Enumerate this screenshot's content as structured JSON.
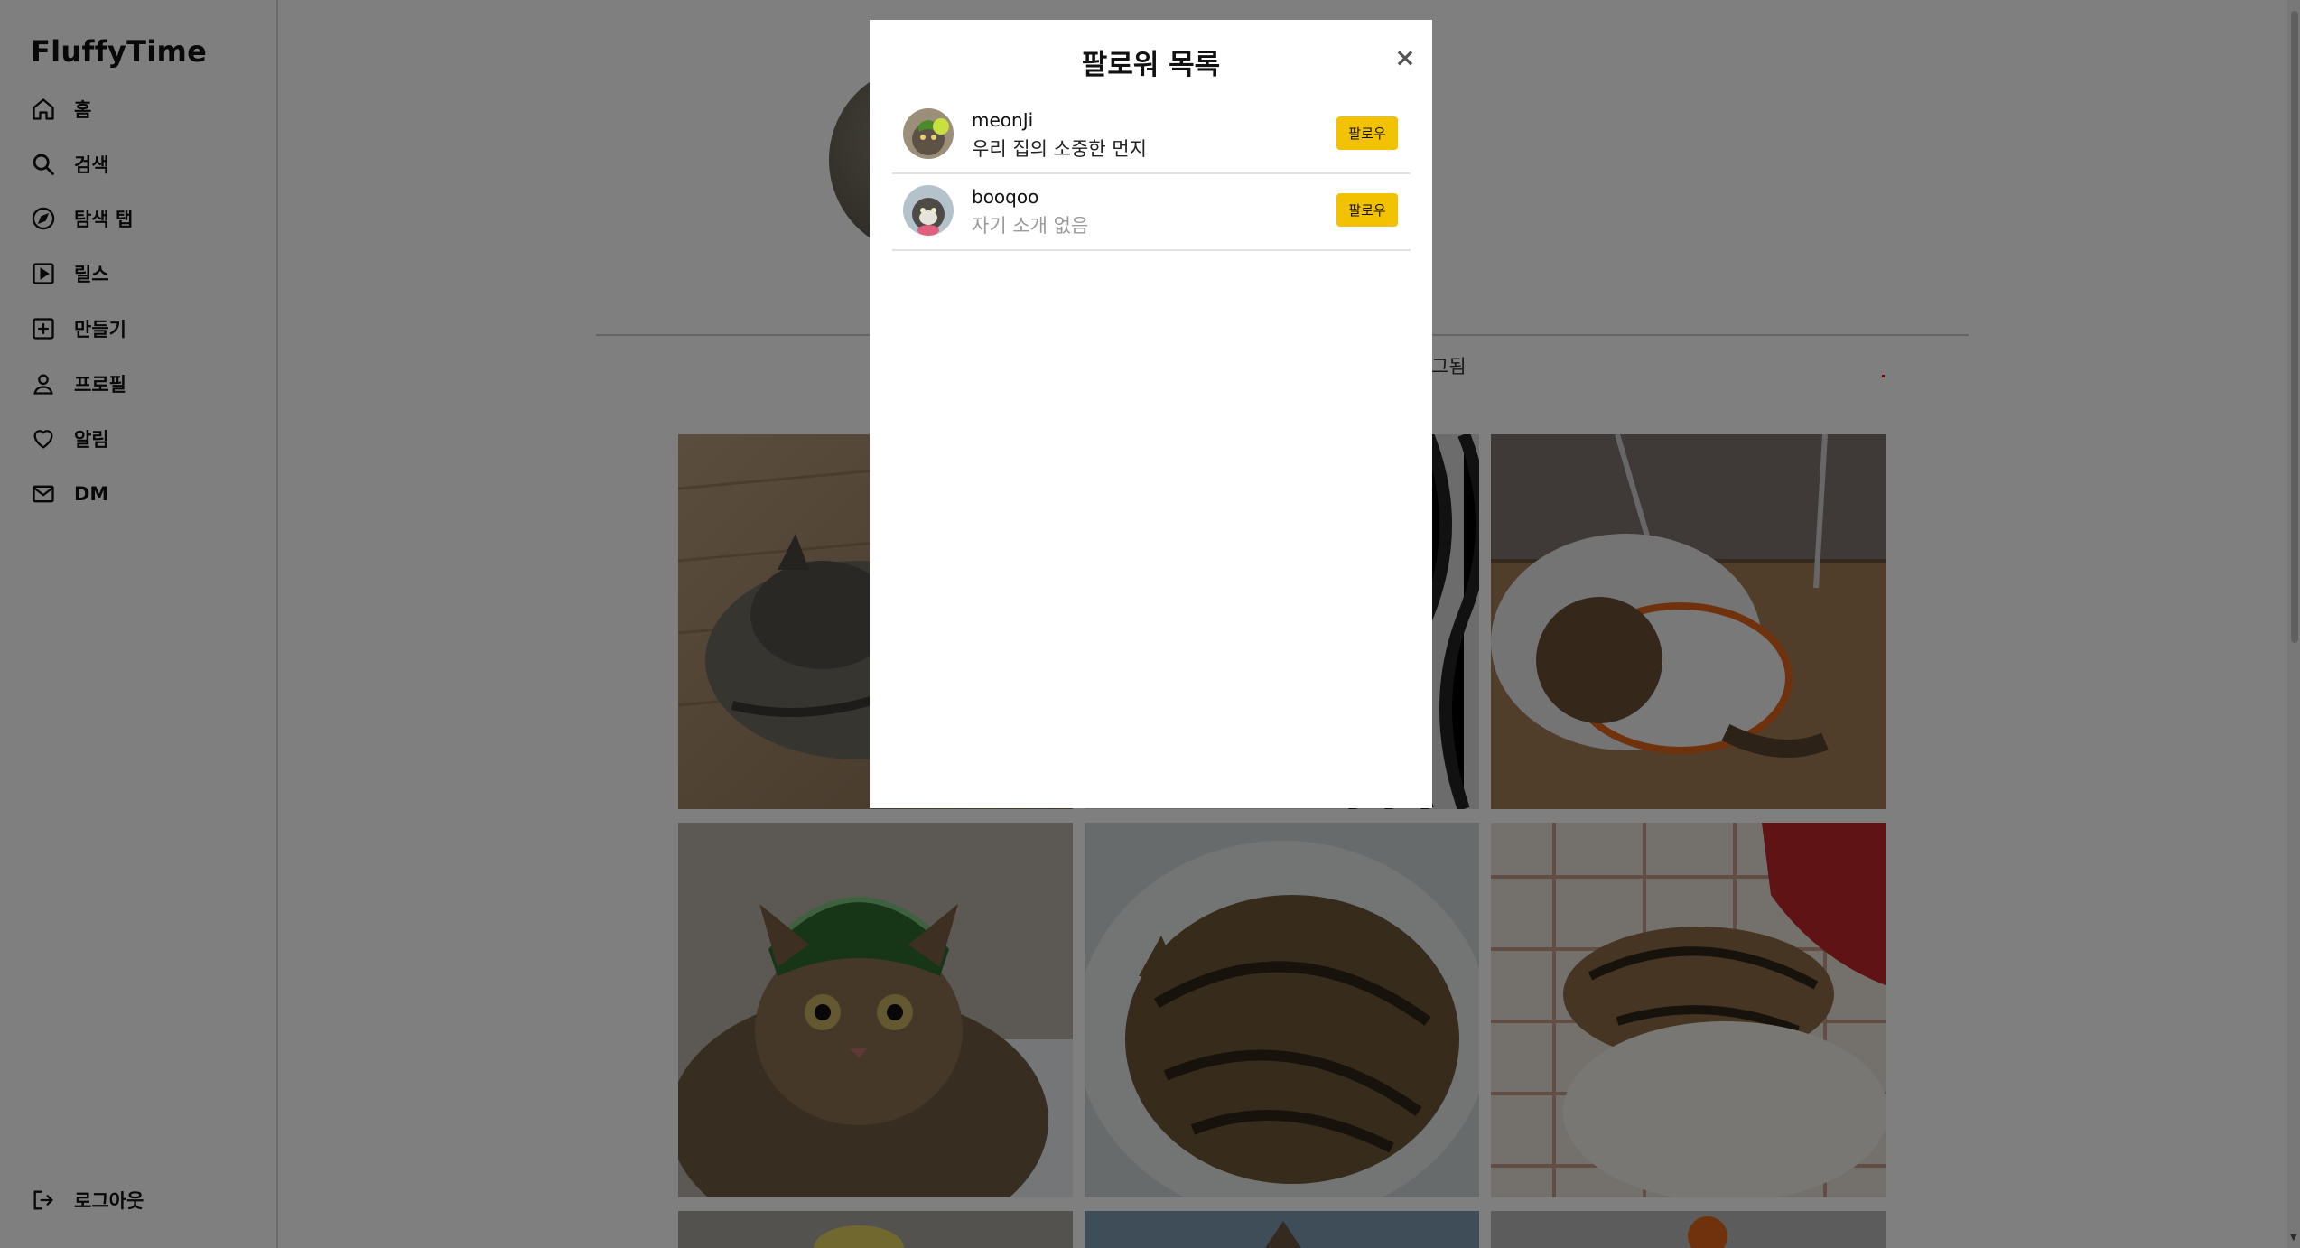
{
  "app": {
    "logo": "FluffyTime"
  },
  "sidebar": {
    "items": [
      {
        "label": "홈",
        "icon": "home-icon"
      },
      {
        "label": "검색",
        "icon": "search-icon"
      },
      {
        "label": "탐색 탭",
        "icon": "compass-icon"
      },
      {
        "label": "릴스",
        "icon": "play-square-icon"
      },
      {
        "label": "만들기",
        "icon": "plus-square-icon"
      },
      {
        "label": "프로필",
        "icon": "user-icon"
      },
      {
        "label": "알림",
        "icon": "heart-icon"
      },
      {
        "label": "DM",
        "icon": "mail-icon"
      }
    ],
    "logout": {
      "label": "로그아웃",
      "icon": "logout-icon"
    }
  },
  "profile": {
    "tab_tagged_partial": "그됨"
  },
  "modal": {
    "title": "팔로워 목록",
    "close_label": "×",
    "followers": [
      {
        "username": "meonJi",
        "bio": "우리 집의 소중한 먼지",
        "button": "팔로우"
      },
      {
        "username": "booqoo",
        "bio": "자기 소개 없음",
        "button": "팔로우"
      }
    ]
  },
  "colors": {
    "follow_button": "#f2c200",
    "overlay": "rgba(0,0,0,0.5)"
  }
}
